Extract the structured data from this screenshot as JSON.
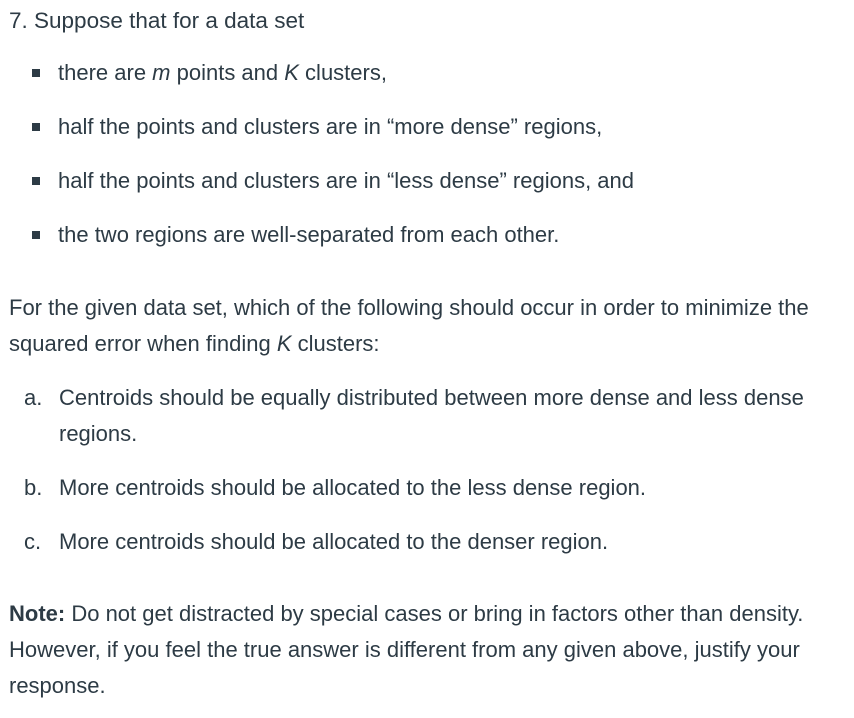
{
  "question": {
    "title": "7. Suppose that for a data set"
  },
  "conditions": [
    {
      "pre": "there are ",
      "em1": "m",
      "mid": " points and ",
      "em2": "K",
      "post": " clusters,"
    },
    {
      "text": "half the points and clusters are in “more dense” regions,"
    },
    {
      "text": "half the points and clusters are in “less dense” regions, and"
    },
    {
      "text": "the two regions are well-separated from each other."
    }
  ],
  "prompt": {
    "pre": "For the given data set, which of the following should occur in order to minimize the squared error when finding ",
    "em": "K",
    "post": " clusters:"
  },
  "options": [
    {
      "letter": "a.",
      "text": "Centroids should be equally distributed between more dense and less dense regions."
    },
    {
      "letter": "b.",
      "text": "More centroids should be allocated to the less dense region."
    },
    {
      "letter": "c.",
      "text": "More centroids should be allocated to the denser region."
    }
  ],
  "note": {
    "label": "Note:",
    "text": " Do not get distracted by special cases or bring in factors other than density. However, if you feel the true answer is different from any given above, justify your response."
  }
}
